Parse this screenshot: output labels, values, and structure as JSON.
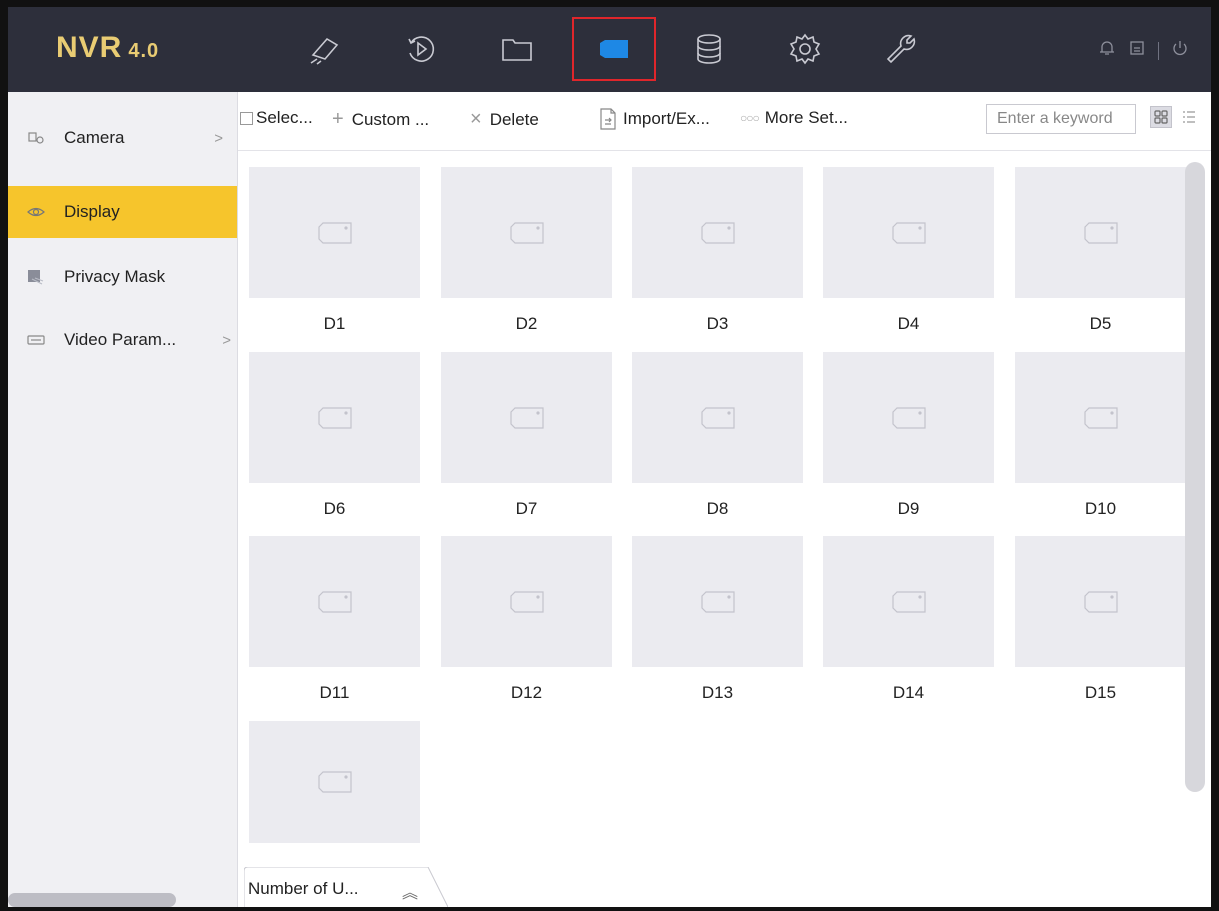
{
  "app": {
    "logo": "NVR",
    "version": "4.0"
  },
  "topnav": [
    {
      "name": "live-view-icon"
    },
    {
      "name": "playback-icon"
    },
    {
      "name": "file-folder-icon"
    },
    {
      "name": "camera-icon",
      "active": true
    },
    {
      "name": "storage-icon"
    },
    {
      "name": "settings-gear-icon"
    },
    {
      "name": "maintenance-wrench-icon"
    }
  ],
  "topright": [
    "bell-icon",
    "lock-screen-icon",
    "power-icon"
  ],
  "sidebar": {
    "items": [
      {
        "label": "Camera",
        "icon": "camera-device-icon",
        "chevron": ">"
      },
      {
        "label": "Display",
        "icon": "eye-icon",
        "active": true
      },
      {
        "label": "Privacy Mask",
        "icon": "privacy-mask-icon"
      },
      {
        "label": "Video Param...",
        "icon": "video-param-icon",
        "chevron": ">"
      }
    ]
  },
  "toolbar": {
    "select": "Selec...",
    "custom": "Custom ...",
    "delete": "Delete",
    "import": "Import/Ex...",
    "more": "More Set...",
    "search_placeholder": "Enter a keyword"
  },
  "channels": [
    "D1",
    "D2",
    "D3",
    "D4",
    "D5",
    "D6",
    "D7",
    "D8",
    "D9",
    "D10",
    "D11",
    "D12",
    "D13",
    "D14",
    "D15",
    ""
  ],
  "bottom_tab": {
    "label": "Number of U..."
  },
  "colors": {
    "topbar": "#2d2f3b",
    "accent": "#f6c52c",
    "active_nav": "#1e88e5",
    "highlight_box": "#e0262b"
  }
}
